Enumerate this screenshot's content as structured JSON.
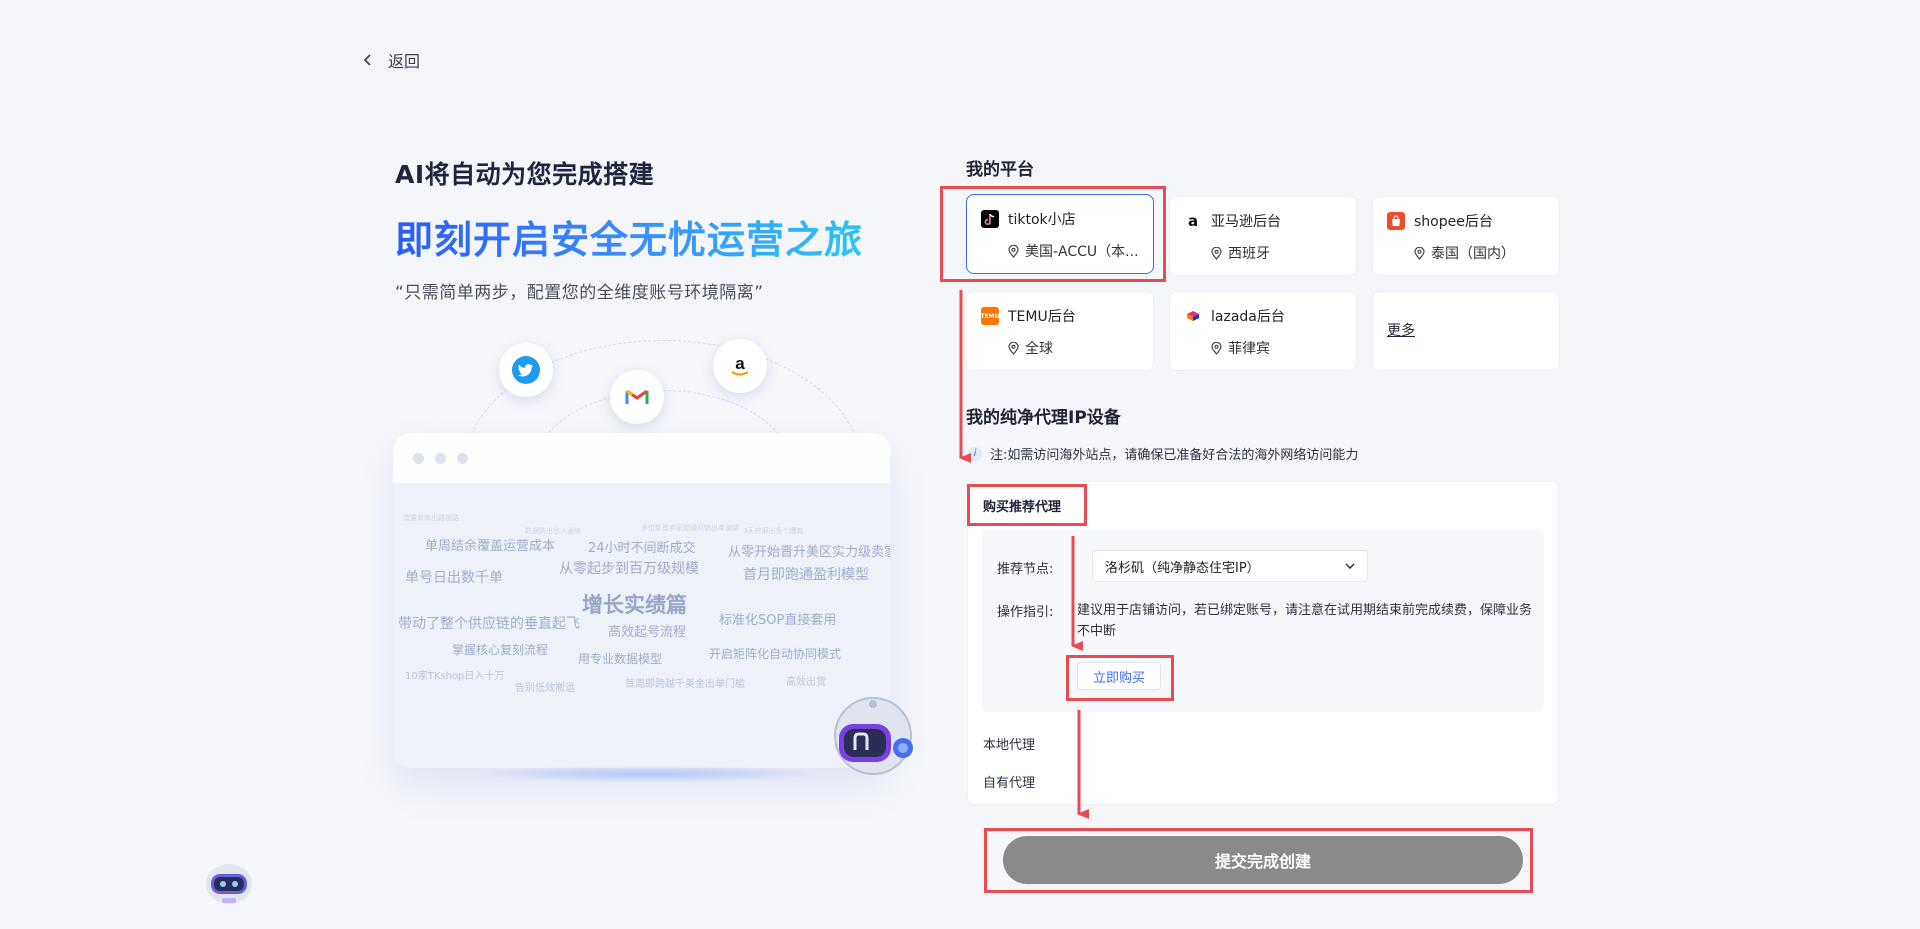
{
  "nav": {
    "back_label": "返回"
  },
  "hero": {
    "subtitle": "AI将自动为您完成搭建",
    "title": "即刻开启安全无忧运营之旅",
    "quote": "“只需简单两步，配置您的全维度账号环境隔离”"
  },
  "illustration": {
    "tags": [
      "单周结余覆盖运营成本",
      "24小时不间断成交",
      "从零开始晋升美区实力级卖家",
      "单号日出数千单",
      "从零起步到百万级规模",
      "首月即跑通盈利模型",
      "增长实绩篇",
      "带动了整个供应链的垂直起飞",
      "高效起号流程",
      "标准化SOP直接套用",
      "掌握核心复刻流程",
      "用专业数据模型",
      "开启矩阵化自动协同模式",
      "10家TKshop日入十万",
      "告别低效搬运",
      "首周即跨越千美金出单门槛",
      "高效出货",
      "数据防出岔入通络",
      "多位新晋卖家跑通月销出单链路",
      "3天挖掘出多个爆款",
      "流量有效出路链路"
    ]
  },
  "platforms": {
    "title": "我的平台",
    "items": [
      {
        "name": "tiktok小店",
        "location": "美国-ACCU（本...",
        "logo": "tiktok-icon",
        "color": "#000000"
      },
      {
        "name": "亚马逊后台",
        "location": "西班牙",
        "logo": "amazon-icon",
        "color": "#ffffff"
      },
      {
        "name": "shopee后台",
        "location": "泰国（国内）",
        "logo": "shopee-icon",
        "color": "#ee4d2d"
      },
      {
        "name": "TEMU后台",
        "location": "全球",
        "logo": "temu-icon",
        "color": "#fb7701"
      },
      {
        "name": "lazada后台",
        "location": "菲律宾",
        "logo": "lazada-icon",
        "color": "#ffffff"
      }
    ],
    "more_label": "更多"
  },
  "proxy": {
    "title": "我的纯净代理IP设备",
    "note": "注:如需访问海外站点，请确保已准备好合法的海外网络访问能力",
    "tab_label": "购买推荐代理",
    "node_label": "推荐节点:",
    "node_value": "洛杉矶（纯净静态住宅IP）",
    "guide_label": "操作指引:",
    "guide_text": "建议用于店铺访问，若已绑定账号，请注意在试用期结束前完成续费，保障业务不中断",
    "buy_label": "立即购买",
    "local_label": "本地代理",
    "own_label": "自有代理"
  },
  "submit": {
    "label": "提交完成创建"
  },
  "colors": {
    "accent": "#3d6cf6",
    "highlight": "#e84b52",
    "submit_bg": "#8a8a8a"
  }
}
